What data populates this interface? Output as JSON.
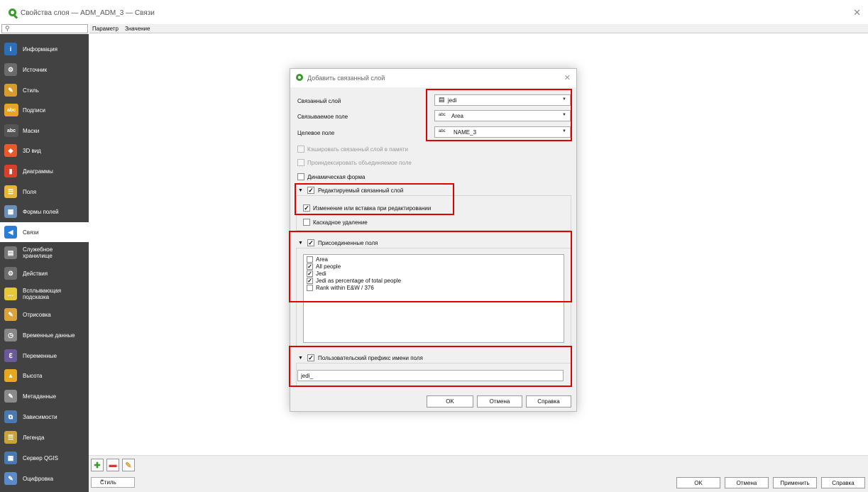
{
  "window": {
    "title": "Свойства слоя — ADM_ADM_3 — Связи",
    "close_icon": "close-icon"
  },
  "table_header": {
    "param": "Параметр",
    "value": "Значение"
  },
  "sidebar": {
    "items": [
      {
        "label": "Информация",
        "icon": "info-icon",
        "color": "#2d6fb6",
        "glyph": "i"
      },
      {
        "label": "Источник",
        "icon": "source-icon",
        "color": "#6b6b6b",
        "glyph": "⚙"
      },
      {
        "label": "Стиль",
        "icon": "style-brush-icon",
        "color": "#d79b2b",
        "glyph": "✎"
      },
      {
        "label": "Подписи",
        "icon": "labels-icon",
        "color": "#e8a321",
        "glyph": "abc"
      },
      {
        "label": "Маски",
        "icon": "masks-icon",
        "color": "#555555",
        "glyph": "abc"
      },
      {
        "label": "3D вид",
        "icon": "3d-view-icon",
        "color": "#e85a2c",
        "glyph": "◆"
      },
      {
        "label": "Диаграммы",
        "icon": "diagrams-icon",
        "color": "#d9402b",
        "glyph": "▮"
      },
      {
        "label": "Поля",
        "icon": "fields-icon",
        "color": "#e6b63a",
        "glyph": "☰"
      },
      {
        "label": "Формы полей",
        "icon": "field-forms-icon",
        "color": "#6c8fb8",
        "glyph": "▦"
      },
      {
        "label": "Связи",
        "icon": "joins-icon",
        "color": "#2a7fd4",
        "glyph": "◀"
      },
      {
        "label": "Служебное хранилище",
        "icon": "auxiliary-storage-icon",
        "color": "#777777",
        "glyph": "▤"
      },
      {
        "label": "Действия",
        "icon": "actions-icon",
        "color": "#6d6d6d",
        "glyph": "⚙"
      },
      {
        "label": "Всплывающая подсказка",
        "icon": "tooltip-icon",
        "color": "#e6c83a",
        "glyph": "…"
      },
      {
        "label": "Отрисовка",
        "icon": "rendering-icon",
        "color": "#d9a23b",
        "glyph": "✎"
      },
      {
        "label": "Временные данные",
        "icon": "temporal-icon",
        "color": "#888888",
        "glyph": "◷"
      },
      {
        "label": "Переменные",
        "icon": "variables-icon",
        "color": "#6a5a9a",
        "glyph": "ℇ"
      },
      {
        "label": "Высота",
        "icon": "elevation-icon",
        "color": "#e6a821",
        "glyph": "▲"
      },
      {
        "label": "Метаданные",
        "icon": "metadata-icon",
        "color": "#8a8a8a",
        "glyph": "✎"
      },
      {
        "label": "Зависимости",
        "icon": "dependencies-icon",
        "color": "#4a78b0",
        "glyph": "⧉"
      },
      {
        "label": "Легенда",
        "icon": "legend-icon",
        "color": "#c8a23a",
        "glyph": "☰"
      },
      {
        "label": "Сервер QGIS",
        "icon": "qgis-server-icon",
        "color": "#4a78b0",
        "glyph": "▦"
      },
      {
        "label": "Оцифровка",
        "icon": "digitizing-icon",
        "color": "#5a8ac8",
        "glyph": "✎"
      }
    ]
  },
  "bottom": {
    "style_label": "Стиль",
    "ok": "OK",
    "cancel": "Отмена",
    "apply": "Применить",
    "help": "Справка"
  },
  "dialog": {
    "title": "Добавить связанный слой",
    "join_layer_label": "Связанный слой",
    "join_layer_value": "jedi",
    "join_field_label": "Связываемое поле",
    "join_field_value": "Area",
    "target_field_label": "Целевое поле",
    "target_field_value": "NAME_3",
    "field_type_prefix": "abc",
    "cache_label": "Кэшировать связанный слой в памяти",
    "index_label": "Проиндексировать объединяемое поле",
    "dynamic_form_label": "Динамическая форма",
    "editable_label": "Редактируемый связанный слой",
    "upsert_label": "Изменение или вставка при редактировании",
    "cascade_label": "Каскадное удаление",
    "joined_fields_label": "Присоединенные поля",
    "fields": [
      {
        "name": "Area",
        "checked": false
      },
      {
        "name": "All people",
        "checked": true
      },
      {
        "name": "Jedi",
        "checked": true
      },
      {
        "name": "Jedi as percentage of total people",
        "checked": true
      },
      {
        "name": "Rank within E&W / 376",
        "checked": false
      }
    ],
    "prefix_label": "Пользовательский префикс имени поля",
    "prefix_value": "jedi_",
    "ok": "OK",
    "cancel": "Отмена",
    "help": "Справка",
    "check_mark": "✓"
  }
}
